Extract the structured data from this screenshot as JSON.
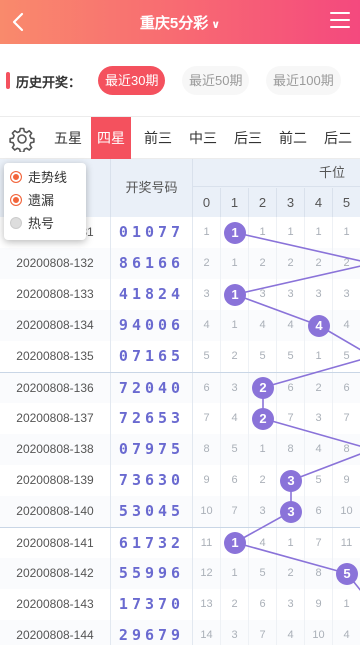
{
  "header": {
    "title": "重庆5分彩",
    "caret": "∨"
  },
  "history": {
    "label": "历史开奖：",
    "periods": [
      {
        "label": "最近30期",
        "active": true
      },
      {
        "label": "最近50期",
        "active": false
      },
      {
        "label": "最近100期",
        "active": false
      }
    ]
  },
  "tabs": [
    {
      "label": "五星",
      "active": false
    },
    {
      "label": "四星",
      "active": true
    },
    {
      "label": "前三",
      "active": false
    },
    {
      "label": "中三",
      "active": false
    },
    {
      "label": "后三",
      "active": false
    },
    {
      "label": "前二",
      "active": false
    },
    {
      "label": "后二",
      "active": false
    }
  ],
  "popup": {
    "options": [
      {
        "label": "走势线",
        "checked": true
      },
      {
        "label": "遗漏",
        "checked": true
      },
      {
        "label": "热号",
        "checked": false
      }
    ]
  },
  "table": {
    "number_header": "开奖号码",
    "group_header": "千位",
    "digit_headers": [
      "0",
      "1",
      "2",
      "3",
      "4",
      "5"
    ],
    "rows": [
      {
        "issue": "20200808-131",
        "numbers": "01077",
        "cells": [
          "1",
          "1",
          "1",
          "1",
          "1",
          "1"
        ],
        "hit": 1
      },
      {
        "issue": "20200808-132",
        "numbers": "86166",
        "cells": [
          "2",
          "1",
          "2",
          "2",
          "2",
          "2"
        ],
        "hit": -1
      },
      {
        "issue": "20200808-133",
        "numbers": "41824",
        "cells": [
          "3",
          "1",
          "3",
          "3",
          "3",
          "3"
        ],
        "hit": 1
      },
      {
        "issue": "20200808-134",
        "numbers": "94006",
        "cells": [
          "4",
          "1",
          "4",
          "4",
          "4",
          "4"
        ],
        "hit": 4
      },
      {
        "issue": "20200808-135",
        "numbers": "07165",
        "cells": [
          "5",
          "2",
          "5",
          "5",
          "1",
          "5"
        ],
        "hit": -1
      },
      {
        "issue": "20200808-136",
        "numbers": "72040",
        "cells": [
          "6",
          "3",
          "2",
          "6",
          "2",
          "6"
        ],
        "hit": 2
      },
      {
        "issue": "20200808-137",
        "numbers": "72653",
        "cells": [
          "7",
          "4",
          "2",
          "7",
          "3",
          "7"
        ],
        "hit": 2
      },
      {
        "issue": "20200808-138",
        "numbers": "07975",
        "cells": [
          "8",
          "5",
          "1",
          "8",
          "4",
          "8"
        ],
        "hit": -1
      },
      {
        "issue": "20200808-139",
        "numbers": "73630",
        "cells": [
          "9",
          "6",
          "2",
          "3",
          "5",
          "9"
        ],
        "hit": 3
      },
      {
        "issue": "20200808-140",
        "numbers": "53045",
        "cells": [
          "10",
          "7",
          "3",
          "3",
          "6",
          "10"
        ],
        "hit": 3
      },
      {
        "issue": "20200808-141",
        "numbers": "61732",
        "cells": [
          "11",
          "1",
          "4",
          "1",
          "7",
          "11"
        ],
        "hit": 1
      },
      {
        "issue": "20200808-142",
        "numbers": "55996",
        "cells": [
          "12",
          "1",
          "5",
          "2",
          "8",
          "5"
        ],
        "hit": 5
      },
      {
        "issue": "20200808-143",
        "numbers": "17370",
        "cells": [
          "13",
          "2",
          "6",
          "3",
          "9",
          "1"
        ],
        "hit": -1
      },
      {
        "issue": "20200808-144",
        "numbers": "29679",
        "cells": [
          "14",
          "3",
          "7",
          "4",
          "10",
          "4"
        ],
        "hit": -1
      }
    ]
  },
  "colors": {
    "accent": "#f4515e",
    "ball": "#8a73d9",
    "line": "#8a73d9",
    "number": "#6a6ad0"
  }
}
